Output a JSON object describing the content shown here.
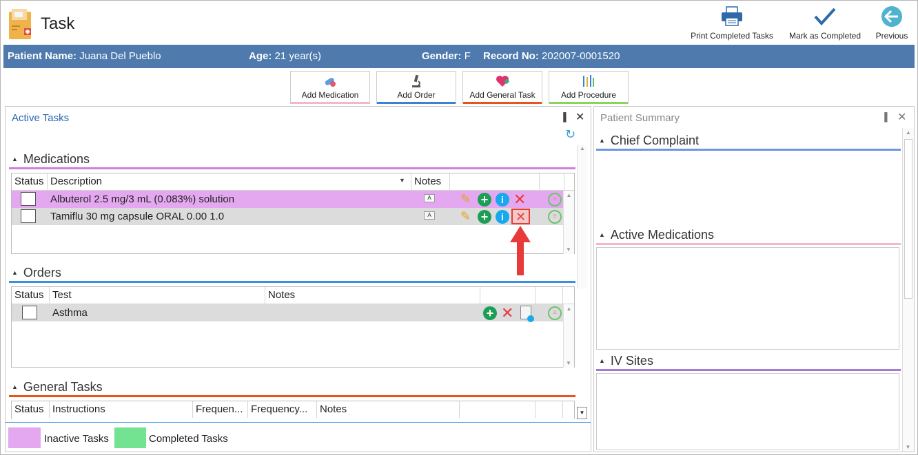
{
  "header": {
    "title": "Task",
    "buttons": [
      {
        "label": "Print Completed Tasks",
        "icon": "printer-icon"
      },
      {
        "label": "Mark as Completed",
        "icon": "checkmark-icon"
      },
      {
        "label": "Previous",
        "icon": "back-arrow-icon"
      }
    ]
  },
  "patient": {
    "name_label": "Patient Name:",
    "name": "Juana Del Pueblo",
    "age_label": "Age:",
    "age": "21 year(s)",
    "gender_label": "Gender:",
    "gender": "F",
    "record_label": "Record No:",
    "record": "202007-0001520"
  },
  "add_buttons": [
    {
      "label": "Add Medication",
      "color": "#f4b7c8"
    },
    {
      "label": "Add Order",
      "color": "#3b82d1"
    },
    {
      "label": "Add General Task",
      "color": "#e8541b"
    },
    {
      "label": "Add Procedure",
      "color": "#8cd35a"
    }
  ],
  "active_tasks": {
    "title": "Active Tasks",
    "medications": {
      "title": "Medications",
      "color": "#d37be0",
      "columns": [
        "Status",
        "Description",
        "Notes"
      ],
      "rows": [
        {
          "description": "Albuterol 2.5 mg/3 mL (0.083%) solution",
          "selected": true
        },
        {
          "description": "Tamiflu 30 mg capsule ORAL 0.00 1.0",
          "selected": false
        }
      ]
    },
    "orders": {
      "title": "Orders",
      "color": "#3b8fe0",
      "columns": [
        "Status",
        "Test",
        "Notes"
      ],
      "rows": [
        {
          "test": "Asthma"
        }
      ]
    },
    "general_tasks": {
      "title": "General Tasks",
      "color": "#e8541b",
      "columns": [
        "Status",
        "Instructions",
        "Frequen...",
        "Frequency...",
        "Notes"
      ]
    },
    "legend": [
      {
        "label": "Inactive Tasks",
        "color": "#e3a8ef"
      },
      {
        "label": "Completed Tasks",
        "color": "#74e391"
      }
    ]
  },
  "patient_summary": {
    "title": "Patient Summary",
    "sections": [
      {
        "title": "Chief Complaint",
        "color": "#6a96e0"
      },
      {
        "title": "Active Medications",
        "color": "#f5b6c6"
      },
      {
        "title": "IV Sites",
        "color": "#a27ad8"
      }
    ]
  }
}
